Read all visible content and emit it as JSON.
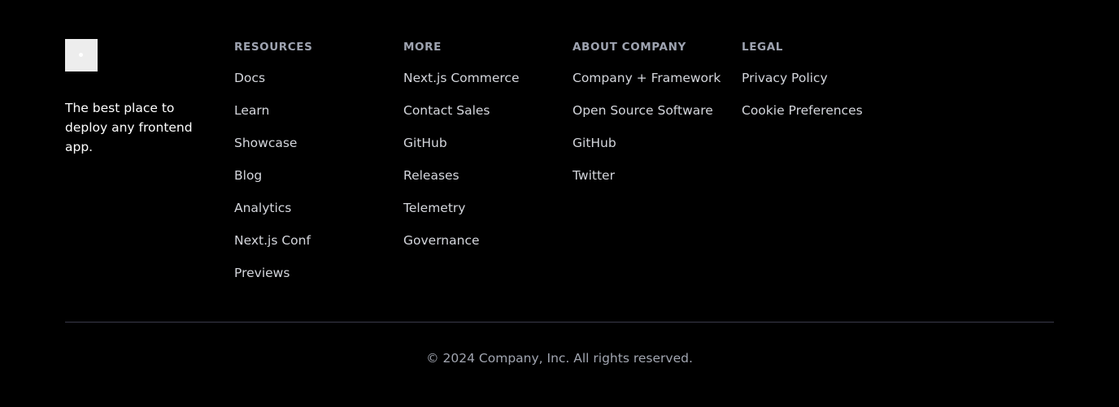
{
  "brand": {
    "logo_icon": "logo-mark",
    "tagline": "The best place to deploy any frontend app."
  },
  "columns": [
    {
      "heading": "RESOURCES",
      "links": [
        "Docs",
        "Learn",
        "Showcase",
        "Blog",
        "Analytics",
        "Next.js Conf",
        "Previews"
      ]
    },
    {
      "heading": "MORE",
      "links": [
        "Next.js Commerce",
        "Contact Sales",
        "GitHub",
        "Releases",
        "Telemetry",
        "Governance"
      ]
    },
    {
      "heading": "ABOUT COMPANY",
      "links": [
        "Company + Framework",
        "Open Source Software",
        "GitHub",
        "Twitter"
      ]
    },
    {
      "heading": "LEGAL",
      "links": [
        "Privacy Policy",
        "Cookie Preferences"
      ]
    }
  ],
  "copyright": "© 2024 Company, Inc. All rights reserved.",
  "colors": {
    "background": "#000000",
    "heading": "#9ea3b0",
    "link": "#d4d6dc",
    "divider": "#3a3a4a"
  }
}
